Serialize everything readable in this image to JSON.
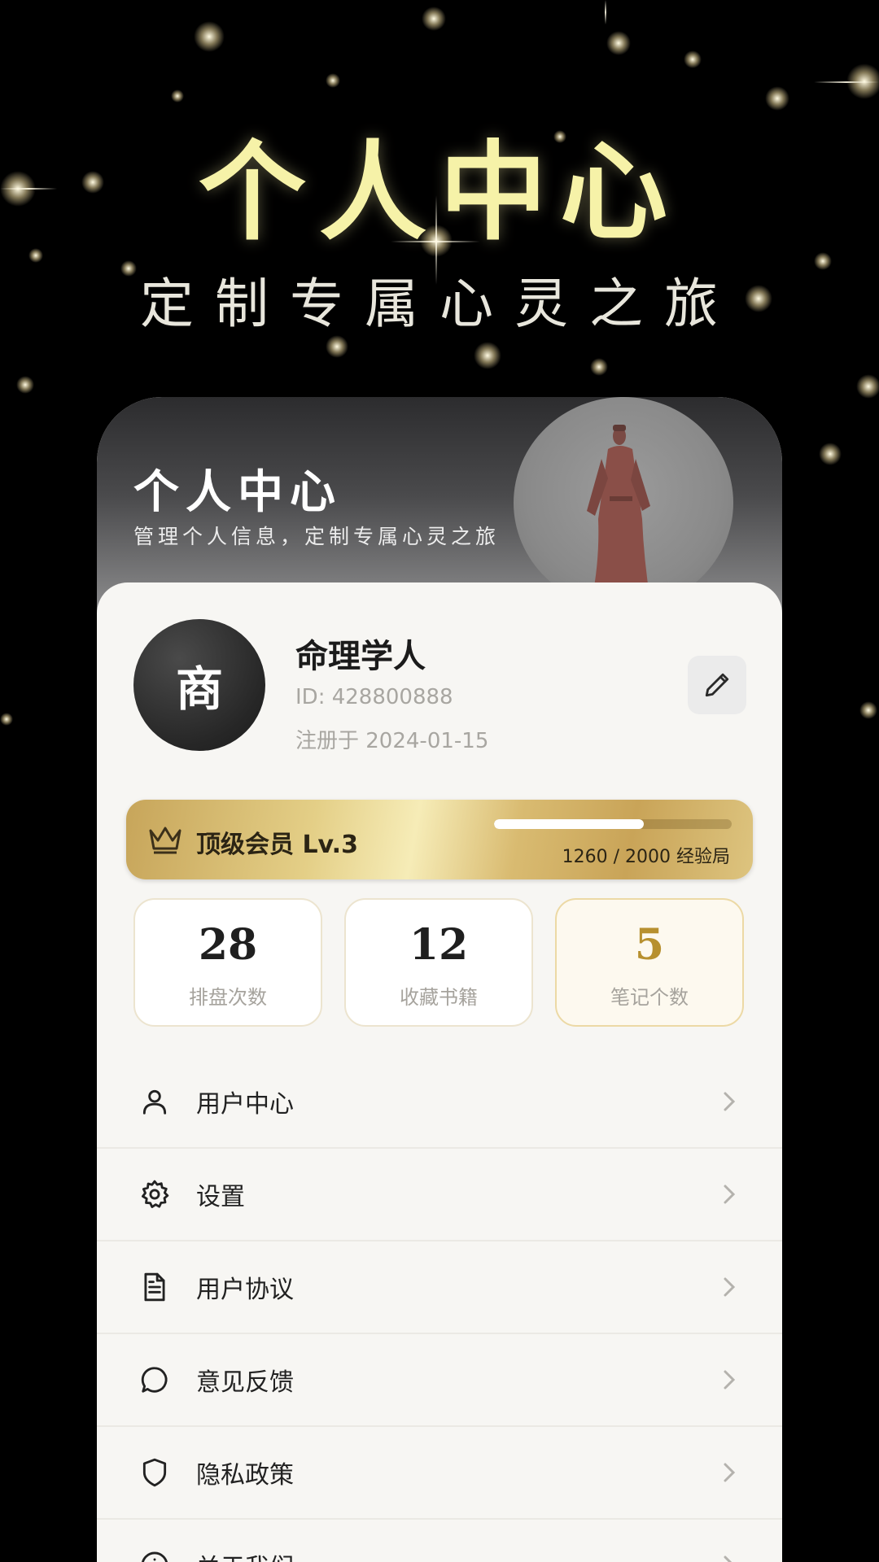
{
  "hero": {
    "title": "个人中心",
    "subtitle": "定制专属心灵之旅"
  },
  "header": {
    "title": "个人中心",
    "subtitle": "管理个人信息，定制专属心灵之旅"
  },
  "profile": {
    "avatar_char": "商",
    "name": "命理学人",
    "id_text": "ID: 428800888",
    "registered_text": "注册于 2024-01-15",
    "edit_icon": "pencil-icon"
  },
  "vip": {
    "label": "顶级会员 Lv.3",
    "progress_text": "1260 / 2000 经验局",
    "current": 1260,
    "total": 2000,
    "icon": "crown-icon"
  },
  "stats": [
    {
      "value": "28",
      "label": "排盘次数"
    },
    {
      "value": "12",
      "label": "收藏书籍"
    },
    {
      "value": "5",
      "label": "笔记个数"
    }
  ],
  "menu": [
    {
      "label": "用户中心",
      "icon": "user-icon"
    },
    {
      "label": "设置",
      "icon": "gear-icon"
    },
    {
      "label": "用户协议",
      "icon": "document-icon"
    },
    {
      "label": "意见反馈",
      "icon": "chat-icon"
    },
    {
      "label": "隐私政策",
      "icon": "shield-icon"
    },
    {
      "label": "关于我们",
      "icon": "info-icon"
    }
  ],
  "colors": {
    "background": "#000000",
    "hero_title": "#f6f2a8",
    "gold": "#b7902f",
    "sheet": "#f7f6f3"
  }
}
